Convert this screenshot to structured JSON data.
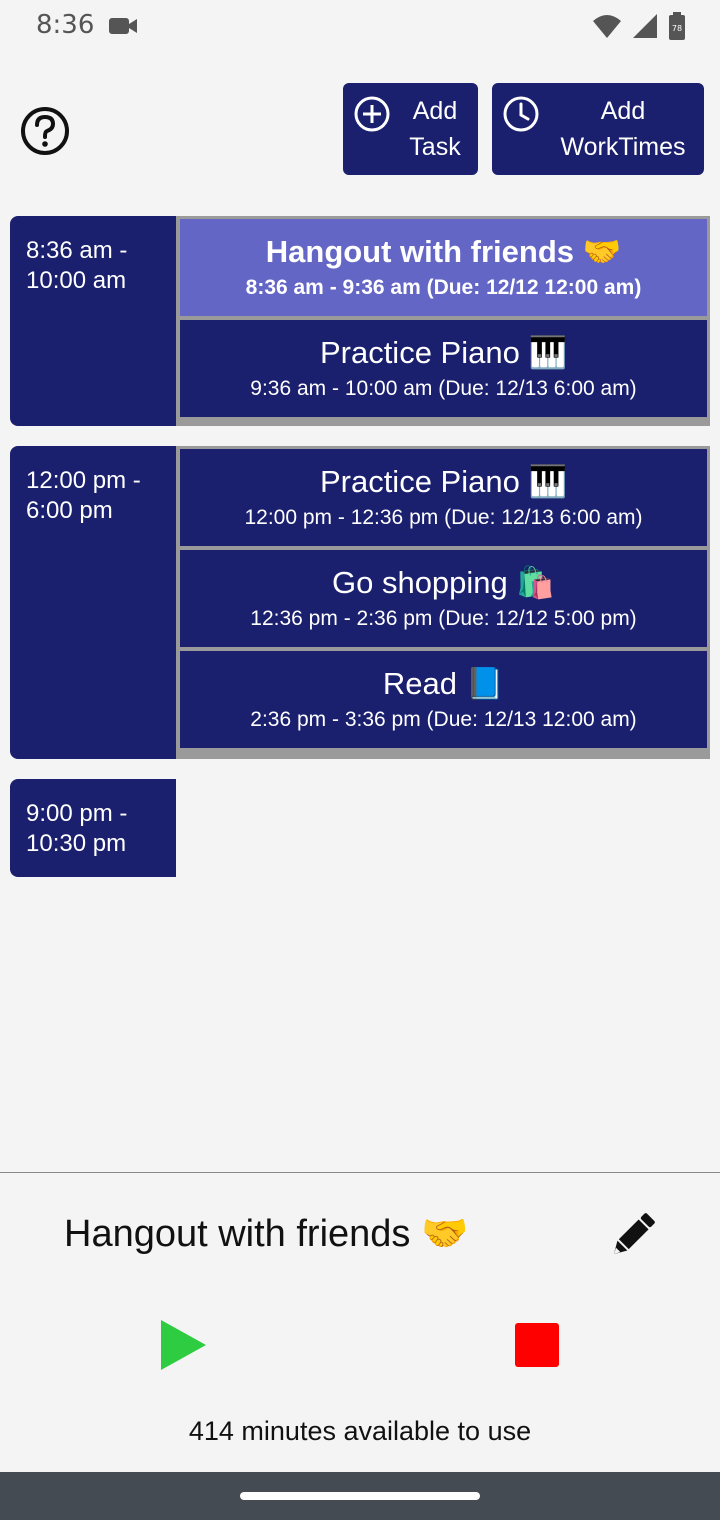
{
  "status_bar": {
    "time": "8:36",
    "battery": "78"
  },
  "toolbar": {
    "add_task_label": "Add Task",
    "add_worktimes_label": "Add WorkTimes"
  },
  "blocks": [
    {
      "time": "8:36 am - 10:00 am",
      "tasks": [
        {
          "name": "Hangout with friends 🤝",
          "time": "8:36 am - 9:36 am (Due: 12/12 12:00 am)",
          "active": true
        },
        {
          "name": "Practice Piano 🎹",
          "time": "9:36 am - 10:00 am (Due: 12/13 6:00 am)"
        }
      ]
    },
    {
      "time": "12:00 pm - 6:00 pm",
      "tasks": [
        {
          "name": "Practice Piano 🎹",
          "time": "12:00 pm - 12:36 pm (Due: 12/13 6:00 am)"
        },
        {
          "name": "Go shopping 🛍️",
          "time": "12:36 pm - 2:36 pm (Due: 12/12 5:00 pm)"
        },
        {
          "name": "Read 📘",
          "time": "2:36 pm - 3:36 pm (Due: 12/13 12:00 am)"
        }
      ]
    },
    {
      "time": "9:00 pm - 10:30 pm",
      "tasks": []
    }
  ],
  "current": {
    "task_name": "Hangout with friends 🤝",
    "minutes_text": "414 minutes available to use"
  },
  "colors": {
    "primary": "#1a1f6e",
    "active_task": "#6466c6",
    "play": "#2ecc40",
    "stop": "#ff0000"
  },
  "icons": {
    "help": "help-circle-icon",
    "add_task": "plus-circle-icon",
    "add_worktimes": "clock-icon",
    "edit": "pencil-icon",
    "play": "play-icon",
    "stop": "stop-icon"
  }
}
